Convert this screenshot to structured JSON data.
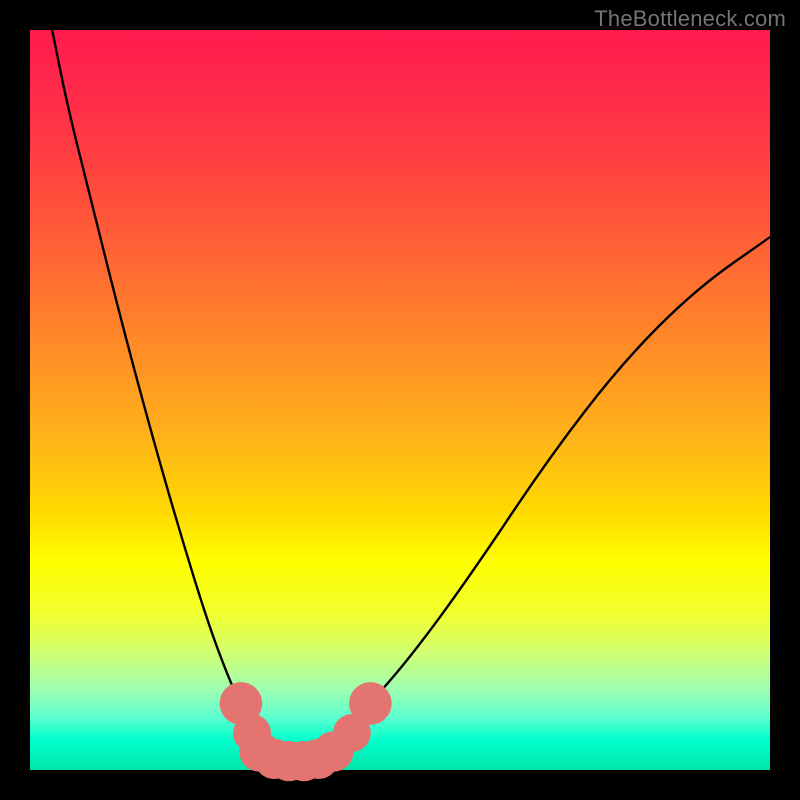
{
  "watermark": "TheBottleneck.com",
  "colors": {
    "black": "#000000",
    "curve": "#000000",
    "marker": "#e4746f",
    "gradient_stops": [
      "#ff1a4d",
      "#ff2a4a",
      "#ff4040",
      "#ff6a33",
      "#ff8f26",
      "#ffb31a",
      "#ffd900",
      "#ffff00",
      "#f0ff30",
      "#d2ff70",
      "#9fffaf",
      "#5affd0",
      "#00ffcc",
      "#00e6a8"
    ]
  },
  "chart_data": {
    "type": "line",
    "title": "",
    "xlabel": "",
    "ylabel": "",
    "xlim": [
      0,
      100
    ],
    "ylim": [
      0,
      100
    ],
    "grid": false,
    "legend": false,
    "note": "V-shaped bottleneck curve on rainbow gradient; y is inverted visually (0 at bottom, 100 at top).",
    "series": [
      {
        "name": "bottleneck-curve",
        "x": [
          3,
          5,
          8,
          12,
          16,
          20,
          24,
          27,
          28.5,
          30,
          31.5,
          33,
          34.5,
          36,
          38,
          40,
          42.5,
          46,
          52,
          60,
          70,
          80,
          90,
          100
        ],
        "y": [
          100,
          90,
          78,
          62,
          47,
          33,
          20,
          12,
          9,
          5,
          2.5,
          1.5,
          1.2,
          1.2,
          1.5,
          2.5,
          5,
          9,
          16,
          27,
          42,
          55,
          65,
          72
        ]
      }
    ],
    "markers": [
      {
        "x": 28.5,
        "y": 9,
        "r": 1.8
      },
      {
        "x": 30.0,
        "y": 5,
        "r": 1.6
      },
      {
        "x": 31.0,
        "y": 2.5,
        "r": 1.7
      },
      {
        "x": 33.0,
        "y": 1.5,
        "r": 1.7
      },
      {
        "x": 35.0,
        "y": 1.2,
        "r": 1.7
      },
      {
        "x": 37.0,
        "y": 1.2,
        "r": 1.7
      },
      {
        "x": 39.0,
        "y": 1.5,
        "r": 1.7
      },
      {
        "x": 41.0,
        "y": 2.5,
        "r": 1.7
      },
      {
        "x": 43.5,
        "y": 5,
        "r": 1.6
      },
      {
        "x": 46.0,
        "y": 9,
        "r": 1.8
      }
    ]
  }
}
